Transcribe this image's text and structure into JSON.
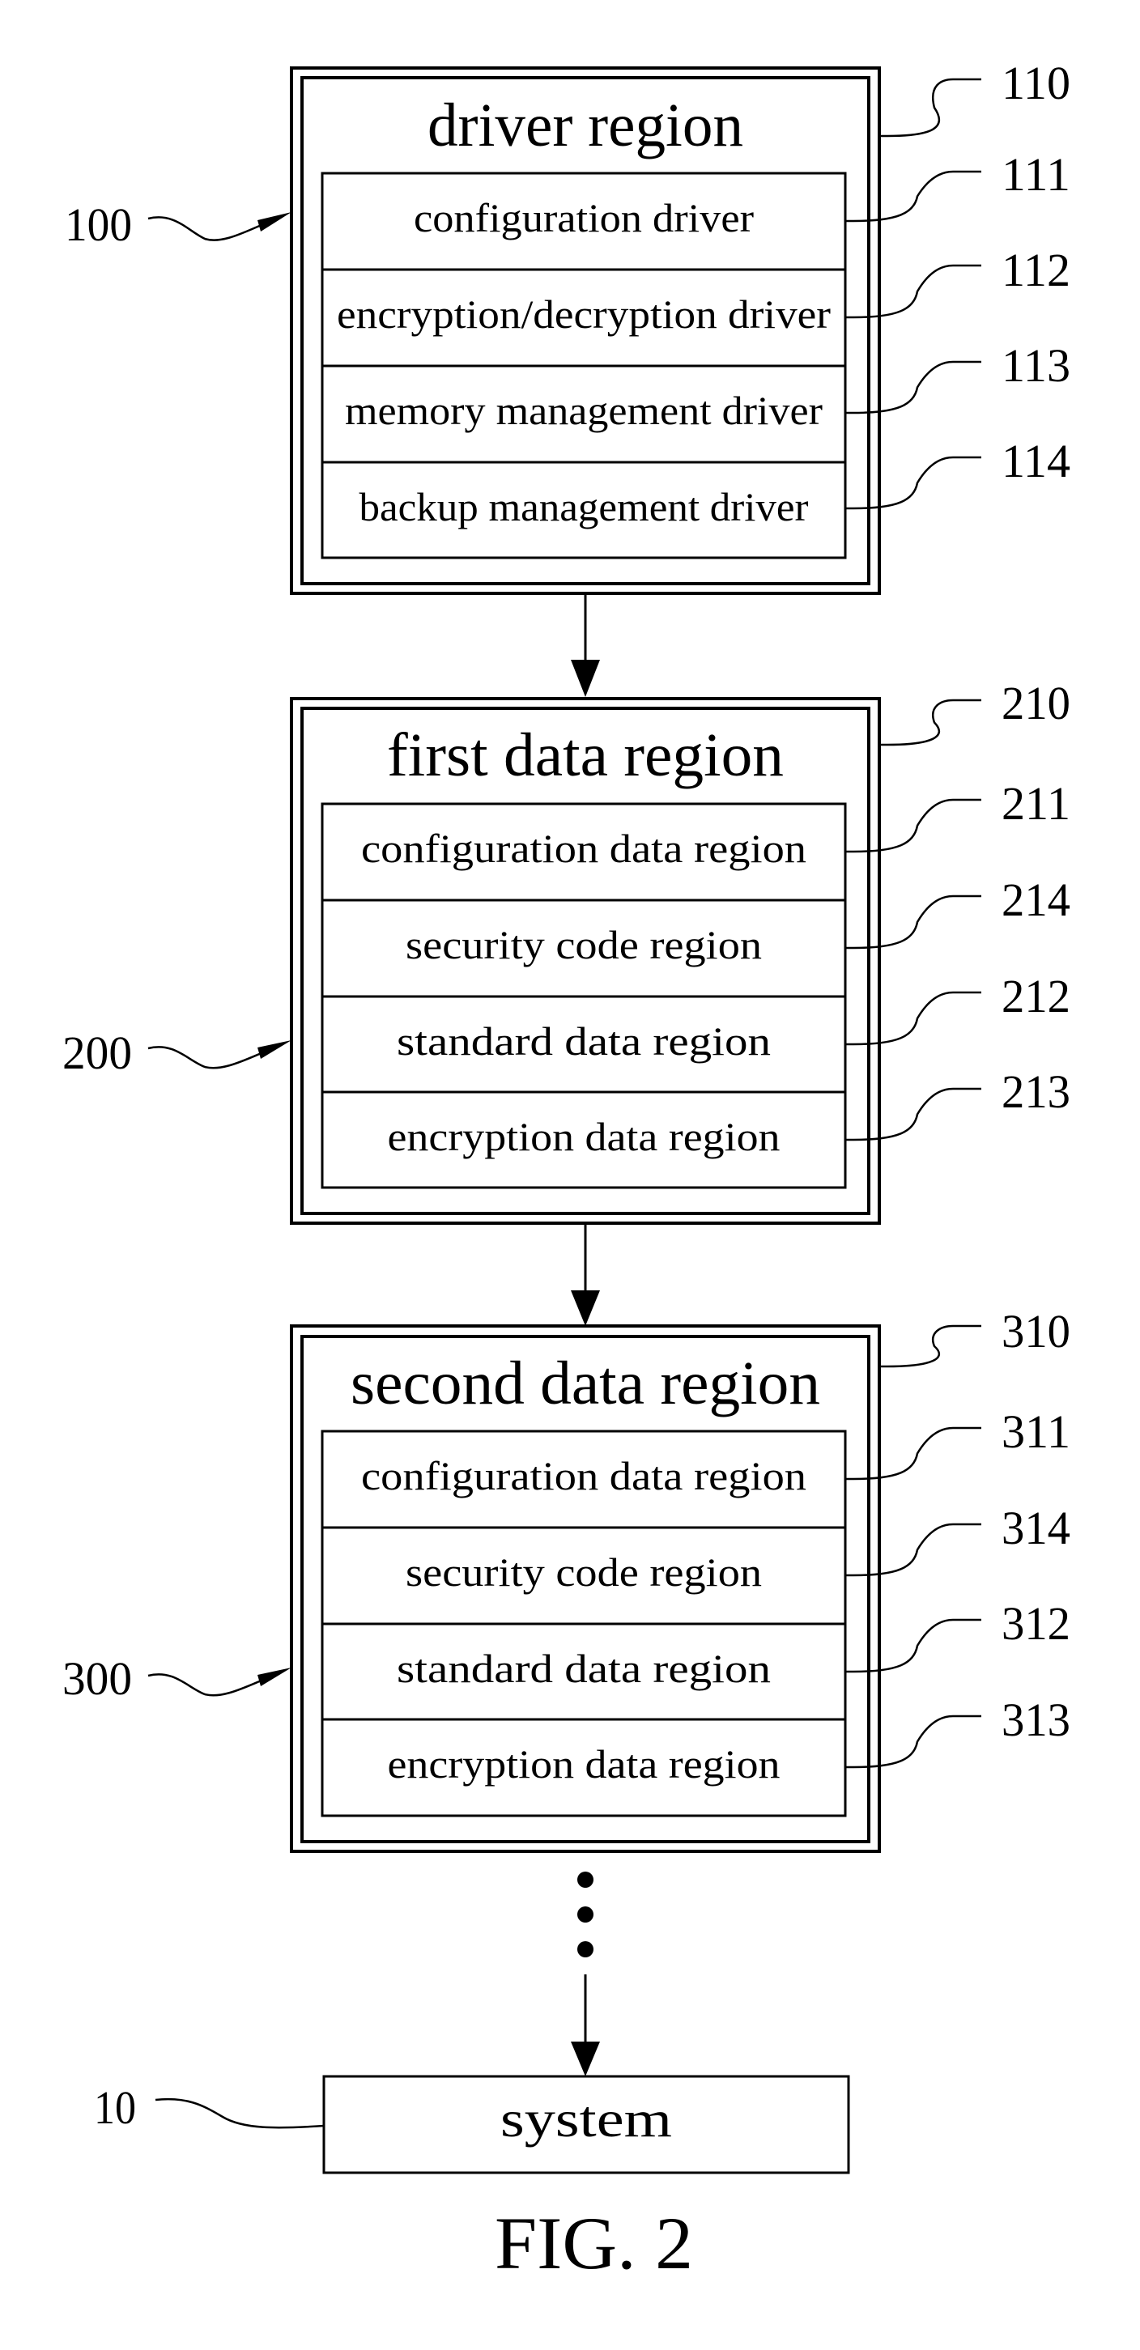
{
  "figure_label": "FIG. 2",
  "regions": [
    {
      "id": "driver-region",
      "ref": "100",
      "box_ref": "110",
      "title": "driver region",
      "rows": [
        {
          "label": "configuration driver",
          "ref": "111"
        },
        {
          "label": "encryption/decryption driver",
          "ref": "112"
        },
        {
          "label": "memory management driver",
          "ref": "113"
        },
        {
          "label": "backup management driver",
          "ref": "114"
        }
      ]
    },
    {
      "id": "first-data-region",
      "ref": "200",
      "box_ref": "210",
      "title": "first data region",
      "rows": [
        {
          "label": "configuration data region",
          "ref": "211"
        },
        {
          "label": "security code region",
          "ref": "214"
        },
        {
          "label": "standard data region",
          "ref": "212"
        },
        {
          "label": "encryption data region",
          "ref": "213"
        }
      ]
    },
    {
      "id": "second-data-region",
      "ref": "300",
      "box_ref": "310",
      "title": "second data region",
      "rows": [
        {
          "label": "configuration data region",
          "ref": "311"
        },
        {
          "label": "security code region",
          "ref": "314"
        },
        {
          "label": "standard data region",
          "ref": "312"
        },
        {
          "label": "encryption data region",
          "ref": "313"
        }
      ]
    }
  ],
  "system": {
    "label": "system",
    "ref": "10"
  }
}
